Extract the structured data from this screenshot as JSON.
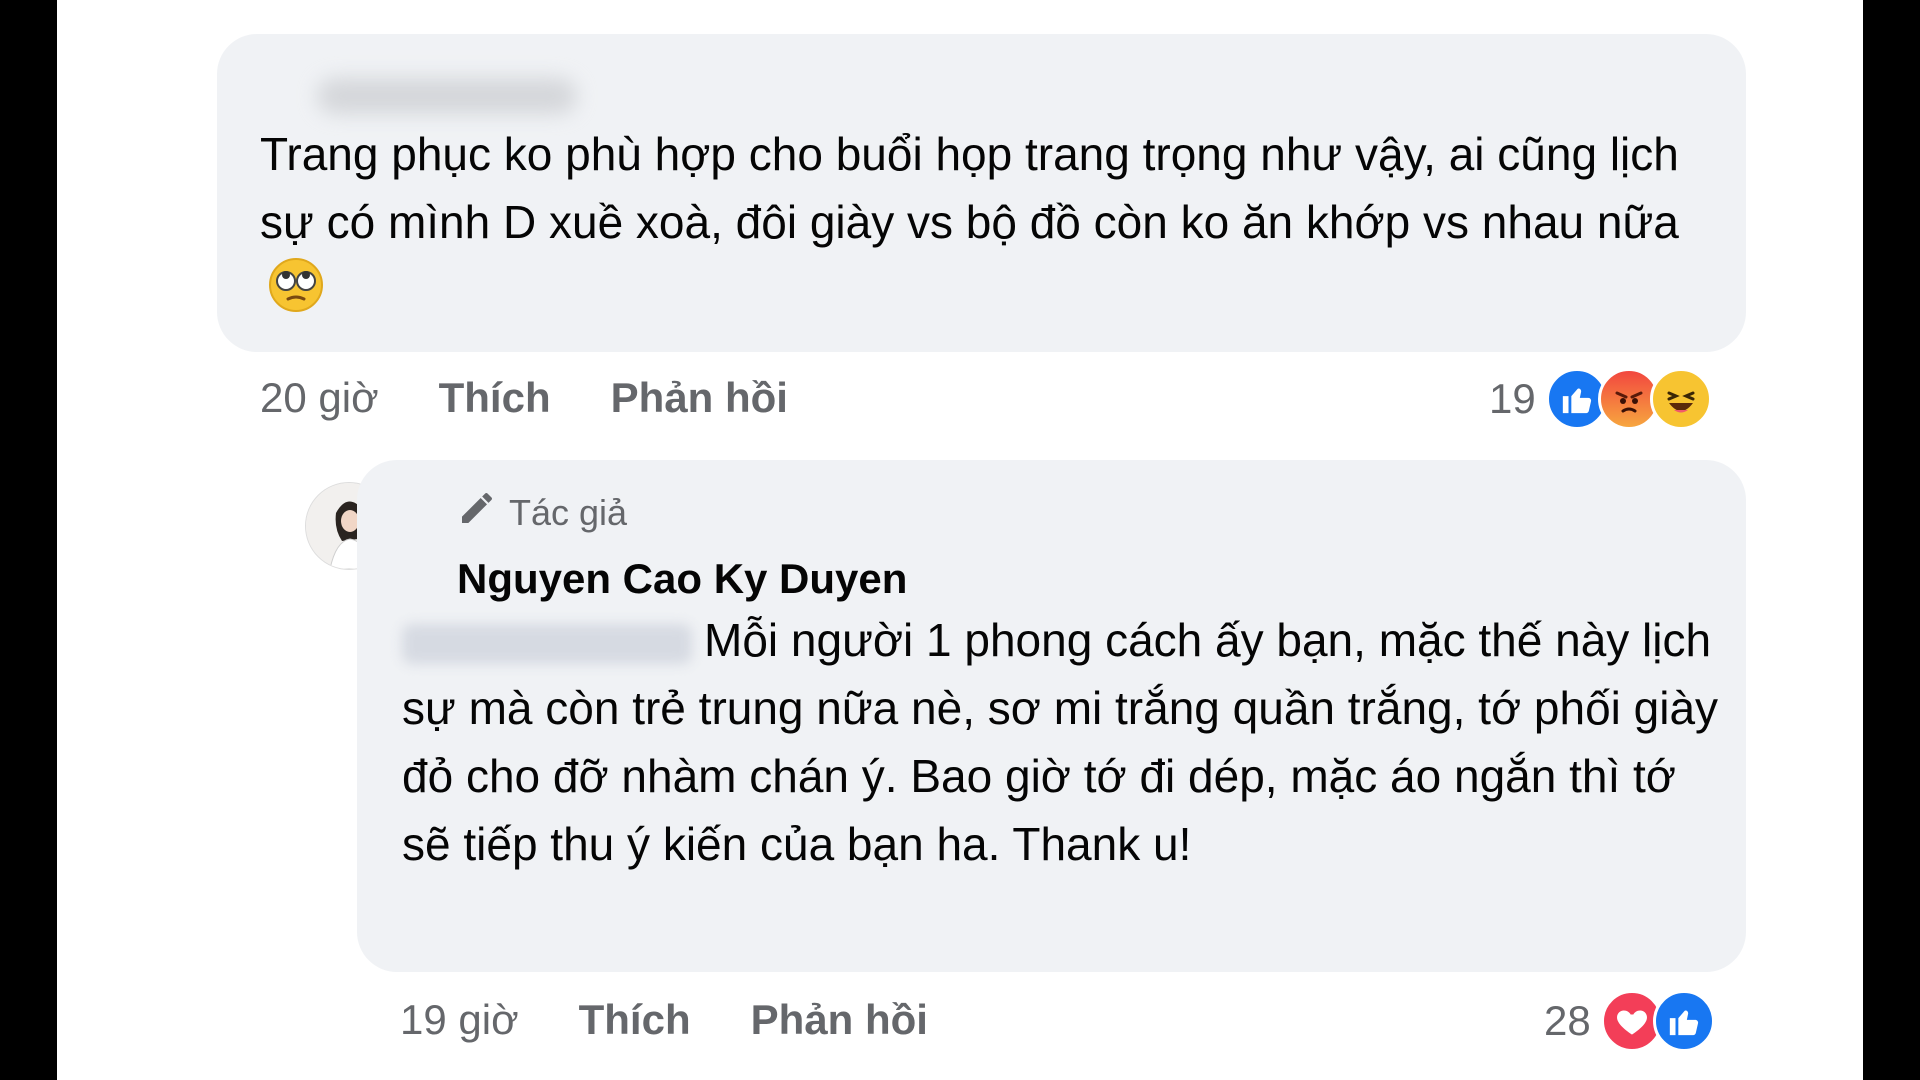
{
  "comment1": {
    "text": "Trang phục ko phù hợp cho buổi họp trang trọng như vậy, ai cũng lịch sự có mình D xuề xoà, đôi giày vs bộ đồ còn ko ăn khớp vs nhau nữa",
    "emoji": "rolling-eyes-emoji",
    "time": "20 giờ",
    "like_label": "Thích",
    "reply_label": "Phản hồi",
    "reaction_count": "19",
    "reactions": [
      "like",
      "angry",
      "haha"
    ]
  },
  "comment2": {
    "badge": "Tác giả",
    "author": "Nguyen Cao Ky Duyen",
    "text": "Mỗi người 1 phong cách ấy bạn, mặc thế này lịch sự mà còn trẻ trung nữa nè, sơ mi trắng quần trắng, tớ phối giày đỏ cho đỡ nhàm chán ý. Bao giờ tớ đi dép, mặc áo ngắn thì tớ sẽ tiếp thu ý kiến của bạn ha. Thank u!",
    "time": "19 giờ",
    "like_label": "Thích",
    "reply_label": "Phản hồi",
    "reaction_count": "28",
    "reactions": [
      "love",
      "like"
    ]
  },
  "colors": {
    "bubble": "#f0f2f5",
    "text": "#050505",
    "secondary": "#65676b",
    "like": "#1877f2",
    "love": "#f33e58"
  }
}
